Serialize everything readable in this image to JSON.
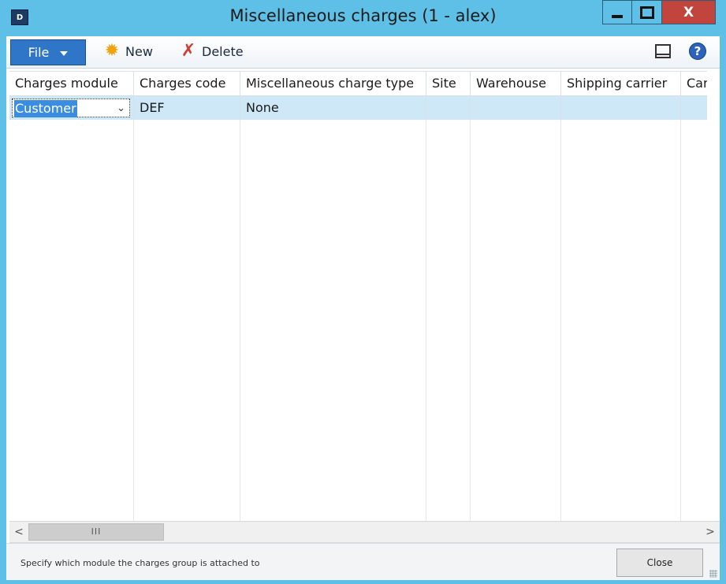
{
  "window": {
    "title": "Miscellaneous charges (1 - alex)",
    "app_icon_text": "D",
    "close_glyph": "X"
  },
  "toolbar": {
    "file_label": "File",
    "new_label": "New",
    "delete_label": "Delete"
  },
  "grid": {
    "columns": [
      "Charges module",
      "Charges code",
      "Miscellaneous charge type",
      "Site",
      "Warehouse",
      "Shipping carrier",
      "Carri"
    ],
    "rows": [
      {
        "charges_module": "Customer",
        "charges_code": "DEF",
        "misc_charge_type": "None",
        "site": "",
        "warehouse": "",
        "shipping_carrier": "",
        "carrier": ""
      }
    ]
  },
  "scrollbar": {
    "left_arrow": "<",
    "right_arrow": ">",
    "thumb_grip": "III"
  },
  "statusbar": {
    "help_text": "Specify which module the charges group is attached to",
    "close_label": "Close"
  },
  "icons": {
    "new": "sun-icon",
    "delete": "red-x-icon",
    "layout": "layout-icon",
    "help": "help-icon"
  },
  "colors": {
    "title_bar": "#5ec0e6",
    "file_button": "#2f75c8",
    "close_window": "#c1453c",
    "selected_row": "#cfe8f8",
    "selected_text": "#3a8de0"
  }
}
